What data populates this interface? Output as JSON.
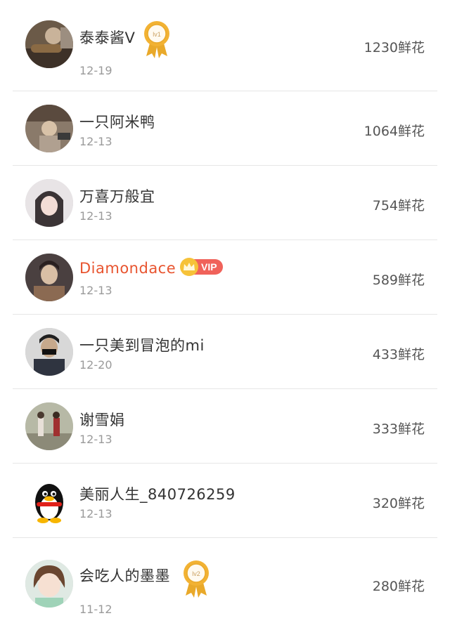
{
  "rows": [
    {
      "name": "泰泰酱V",
      "date": "12-19",
      "flowers": "1230鲜花",
      "badge": "lv1"
    },
    {
      "name": "一只阿米鸭",
      "date": "12-13",
      "flowers": "1064鲜花"
    },
    {
      "name": "万喜万般宜",
      "date": "12-13",
      "flowers": "754鲜花"
    },
    {
      "name": "Diamondace",
      "date": "12-13",
      "flowers": "589鲜花",
      "vip": "VIP"
    },
    {
      "name": "一只美到冒泡的mi",
      "date": "12-20",
      "flowers": "433鲜花"
    },
    {
      "name": "谢雪娟",
      "date": "12-13",
      "flowers": "333鲜花"
    },
    {
      "name": "美丽人生_840726259",
      "date": "12-13",
      "flowers": "320鲜花"
    },
    {
      "name": "会吃人的墨墨",
      "date": "11-12",
      "flowers": "280鲜花",
      "badge": "lv2"
    }
  ],
  "colors": {
    "vip_name": "#e8542f",
    "vip_badge": "#f0625a",
    "crown": "#f6c239",
    "medal": "#f2b233"
  },
  "icons": [
    "user-avatar",
    "medal-badge-icon",
    "crown-icon",
    "qq-penguin-icon"
  ]
}
